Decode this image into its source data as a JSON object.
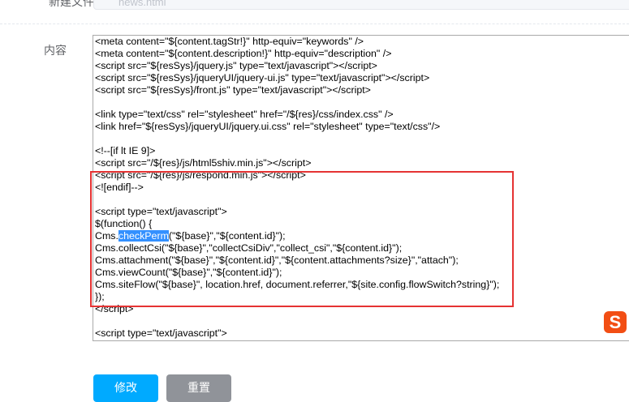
{
  "form": {
    "filename_label": "新建文件",
    "filename_value": "news.html",
    "content_label": "内容"
  },
  "editor": {
    "lines": [
      "<meta content=\"${content.tagStr!}\" http-equiv=\"keywords\" />",
      "<meta content=\"${content.description!}\" http-equiv=\"description\" />",
      "<script src=\"${resSys}/jquery.js\" type=\"text/javascript\"></script>",
      "<script src=\"${resSys}/jqueryUI/jquery-ui.js\" type=\"text/javascript\"></script>",
      "<script src=\"${resSys}/front.js\" type=\"text/javascript\"></script>",
      "",
      "<link type=\"text/css\" rel=\"stylesheet\" href=\"/${res}/css/index.css\" />",
      "<link href=\"${resSys}/jqueryUI/jquery.ui.css\" rel=\"stylesheet\" type=\"text/css\"/>",
      "",
      "<!--[if lt IE 9]>",
      "<script src=\"/${res}/js/html5shiv.min.js\"></script>",
      "<script src=\"/${res}/js/respond.min.js\"></script>",
      "<![endif]-->",
      "",
      "<script type=\"text/javascript\">",
      "$(function() {"
    ],
    "selected_line": {
      "before": "Cms.",
      "selected": "checkPerm",
      "after": "(\"${base}\",\"${content.id}\");"
    },
    "lines_after": [
      "Cms.collectCsi(\"${base}\",\"collectCsiDiv\",\"collect_csi\",\"${content.id}\");",
      "Cms.attachment(\"${base}\",\"${content.id}\",\"${content.attachments?size}\",\"attach\");",
      "Cms.viewCount(\"${base}\",\"${content.id}\");",
      "Cms.siteFlow(\"${base}\", location.href, document.referrer,\"${site.config.flowSwitch?string}\");",
      "});",
      "</script>",
      "",
      "<script type=\"text/javascript\">"
    ]
  },
  "ime_icon_label": "S",
  "buttons": {
    "save": "修改",
    "reset": "重置"
  },
  "colors": {
    "primary": "#00aaff",
    "reset": "#909399",
    "highlight_box": "#e53333",
    "selection": "#3390ff"
  }
}
